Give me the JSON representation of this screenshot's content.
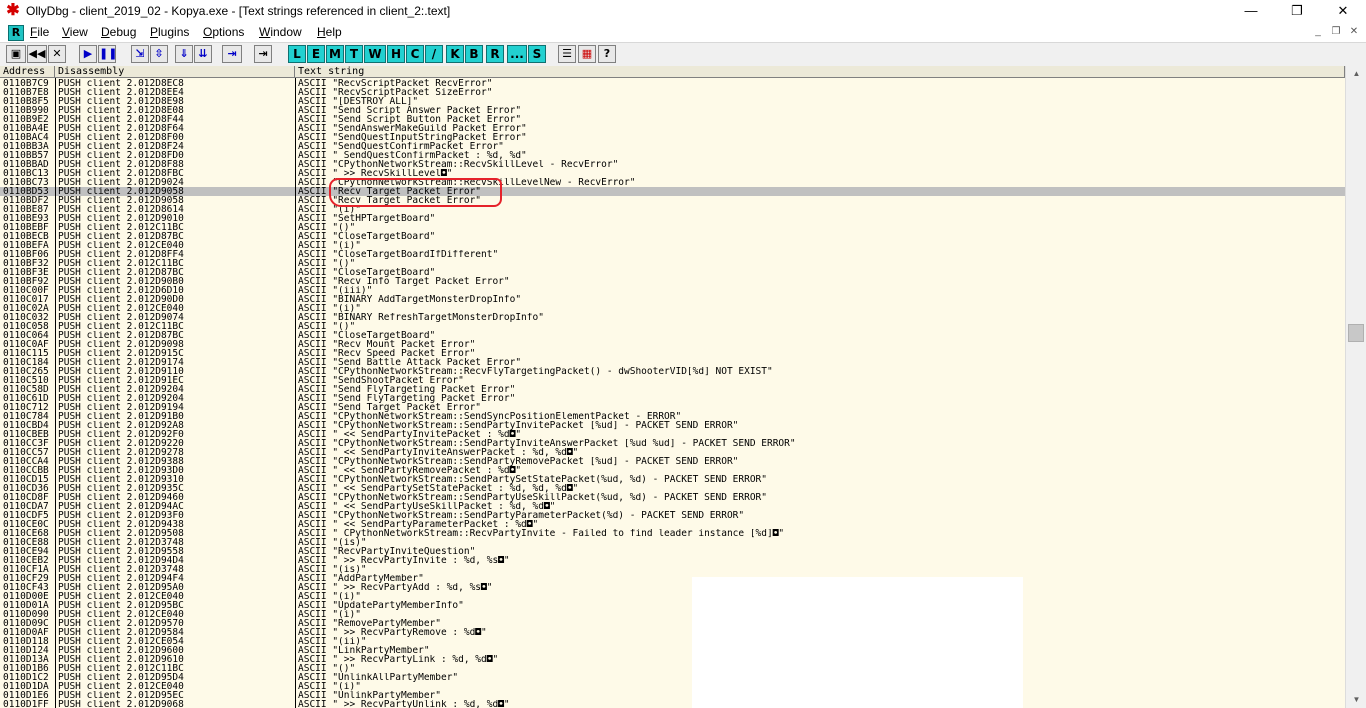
{
  "window": {
    "title": "OllyDbg - client_2019_02 - Kopya.exe - [Text strings referenced in client_2:.text]",
    "minimize_glyph": "—",
    "restore_glyph": "❐",
    "close_glyph": "✕",
    "app_icon_glyph": "✱"
  },
  "menubar": {
    "r_label": "R",
    "items": [
      {
        "u": "F",
        "rest": "ile"
      },
      {
        "u": "V",
        "rest": "iew"
      },
      {
        "u": "D",
        "rest": "ebug"
      },
      {
        "u": "P",
        "rest": "lugins"
      },
      {
        "u": "O",
        "rest": "ptions"
      },
      {
        "u": "W",
        "rest": "indow"
      },
      {
        "u": "H",
        "rest": "elp"
      }
    ],
    "mdi": {
      "min": "_",
      "restore": "❐",
      "close": "✕"
    }
  },
  "toolbar": {
    "buttons": [
      "▣",
      "◀◀",
      "✕",
      "▶",
      "❚❚",
      "⇲",
      "⇳",
      "⇓",
      "⇊",
      "⇥"
    ],
    "letters": [
      "L",
      "E",
      "M",
      "T",
      "W",
      "H",
      "C",
      "/",
      "K",
      "B",
      "R",
      "...",
      "S"
    ],
    "extra": [
      "☰",
      "▦",
      "?"
    ]
  },
  "columns": {
    "address": "Address",
    "disassembly": "Disassembly",
    "text": "Text string"
  },
  "rows": [
    {
      "a": "0110B7C9",
      "d": "PUSH client_2.012D8EC8",
      "t": "ASCII \"RecvScriptPacket_RecvError\""
    },
    {
      "a": "0110B7E8",
      "d": "PUSH client_2.012D8EE4",
      "t": "ASCII \"RecvScriptPacket_SizeError\""
    },
    {
      "a": "0110B8F5",
      "d": "PUSH client_2.012D8E98",
      "t": "ASCII \"[DESTROY_ALL]\""
    },
    {
      "a": "0110B990",
      "d": "PUSH client_2.012D8E08",
      "t": "ASCII \"Send Script Answer Packet Error\""
    },
    {
      "a": "0110B9E2",
      "d": "PUSH client_2.012D8F44",
      "t": "ASCII \"Send Script Button Packet Error\""
    },
    {
      "a": "0110BA4E",
      "d": "PUSH client_2.012D8F64",
      "t": "ASCII \"SendAnswerMakeGuild Packet Error\""
    },
    {
      "a": "0110BAC4",
      "d": "PUSH client_2.012D8F00",
      "t": "ASCII \"SendQuestInputStringPacket Error\""
    },
    {
      "a": "0110BB3A",
      "d": "PUSH client_2.012D8F24",
      "t": "ASCII \"SendQuestConfirmPacket Error\""
    },
    {
      "a": "0110BB57",
      "d": "PUSH client_2.012D8FD0",
      "t": "ASCII \" SendQuestConfirmPacket : %d, %d\""
    },
    {
      "a": "0110BBAD",
      "d": "PUSH client_2.012D8F88",
      "t": "ASCII \"CPythonNetworkStream::RecvSkillLevel - RecvError\""
    },
    {
      "a": "0110BC13",
      "d": "PUSH client_2.012D8FBC",
      "t": "ASCII \" >> RecvSkillLevel◘\""
    },
    {
      "a": "0110BC73",
      "d": "PUSH client_2.012D9024",
      "t": "ASCII \"CPythonNetworkStream::RecvSkillLevelNew - RecvError\""
    },
    {
      "a": "0110BD53",
      "d": "PUSH client_2.012D9058",
      "t": "ASCII \"Recv Target Packet Error\"",
      "sel": true
    },
    {
      "a": "0110BDF2",
      "d": "PUSH client_2.012D9058",
      "t": "ASCII \"Recv Target Packet Error\""
    },
    {
      "a": "0110BE87",
      "d": "PUSH client_2.012D8614",
      "t": "ASCII \"(i)\""
    },
    {
      "a": "0110BE93",
      "d": "PUSH client_2.012D9010",
      "t": "ASCII \"SetHPTargetBoard\""
    },
    {
      "a": "0110BEBF",
      "d": "PUSH client_2.012C11BC",
      "t": "ASCII \"()\""
    },
    {
      "a": "0110BECB",
      "d": "PUSH client_2.012D87BC",
      "t": "ASCII \"CloseTargetBoard\""
    },
    {
      "a": "0110BEFA",
      "d": "PUSH client_2.012CE040",
      "t": "ASCII \"(i)\""
    },
    {
      "a": "0110BF06",
      "d": "PUSH client_2.012D8FF4",
      "t": "ASCII \"CloseTargetBoardIfDifferent\""
    },
    {
      "a": "0110BF32",
      "d": "PUSH client_2.012C11BC",
      "t": "ASCII \"()\""
    },
    {
      "a": "0110BF3E",
      "d": "PUSH client_2.012D87BC",
      "t": "ASCII \"CloseTargetBoard\""
    },
    {
      "a": "0110BF92",
      "d": "PUSH client_2.012D90B0",
      "t": "ASCII \"Recv Info Target Packet Error\""
    },
    {
      "a": "0110C00F",
      "d": "PUSH client_2.012D6D10",
      "t": "ASCII \"(iii)\""
    },
    {
      "a": "0110C017",
      "d": "PUSH client_2.012D90D0",
      "t": "ASCII \"BINARY_AddTargetMonsterDropInfo\""
    },
    {
      "a": "0110C02A",
      "d": "PUSH client_2.012CE040",
      "t": "ASCII \"(i)\""
    },
    {
      "a": "0110C032",
      "d": "PUSH client_2.012D9074",
      "t": "ASCII \"BINARY_RefreshTargetMonsterDropInfo\""
    },
    {
      "a": "0110C058",
      "d": "PUSH client_2.012C11BC",
      "t": "ASCII \"()\""
    },
    {
      "a": "0110C064",
      "d": "PUSH client_2.012D87BC",
      "t": "ASCII \"CloseTargetBoard\""
    },
    {
      "a": "0110C0AF",
      "d": "PUSH client_2.012D9098",
      "t": "ASCII \"Recv Mount Packet Error\""
    },
    {
      "a": "0110C115",
      "d": "PUSH client_2.012D915C",
      "t": "ASCII \"Recv Speed Packet Error\""
    },
    {
      "a": "0110C184",
      "d": "PUSH client_2.012D9174",
      "t": "ASCII \"Send Battle Attack Packet Error\""
    },
    {
      "a": "0110C265",
      "d": "PUSH client_2.012D9110",
      "t": "ASCII \"CPythonNetworkStream::RecvFlyTargetingPacket() - dwShooterVID[%d] NOT EXIST\""
    },
    {
      "a": "0110C510",
      "d": "PUSH client_2.012D91EC",
      "t": "ASCII \"SendShootPacket Error\""
    },
    {
      "a": "0110C58D",
      "d": "PUSH client_2.012D9204",
      "t": "ASCII \"Send FlyTargeting Packet Error\""
    },
    {
      "a": "0110C61D",
      "d": "PUSH client_2.012D9204",
      "t": "ASCII \"Send FlyTargeting Packet Error\""
    },
    {
      "a": "0110C712",
      "d": "PUSH client_2.012D9194",
      "t": "ASCII \"Send Target Packet Error\""
    },
    {
      "a": "0110C784",
      "d": "PUSH client_2.012D91B0",
      "t": "ASCII \"CPythonNetworkStream::SendSyncPositionElementPacket - ERROR\""
    },
    {
      "a": "0110CBD4",
      "d": "PUSH client_2.012D92A8",
      "t": "ASCII \"CPythonNetworkStream::SendPartyInvitePacket [%ud] - PACKET SEND ERROR\""
    },
    {
      "a": "0110CBEB",
      "d": "PUSH client_2.012D92F0",
      "t": "ASCII \" << SendPartyInvitePacket : %d◘\""
    },
    {
      "a": "0110CC3F",
      "d": "PUSH client_2.012D9220",
      "t": "ASCII \"CPythonNetworkStream::SendPartyInviteAnswerPacket [%ud %ud] - PACKET SEND ERROR\""
    },
    {
      "a": "0110CC57",
      "d": "PUSH client_2.012D9278",
      "t": "ASCII \" << SendPartyInviteAnswerPacket : %d, %d◘\""
    },
    {
      "a": "0110CCA4",
      "d": "PUSH client_2.012D9388",
      "t": "ASCII \"CPythonNetworkStream::SendPartyRemovePacket [%ud] - PACKET SEND ERROR\""
    },
    {
      "a": "0110CCBB",
      "d": "PUSH client_2.012D93D0",
      "t": "ASCII \" << SendPartyRemovePacket : %d◘\""
    },
    {
      "a": "0110CD15",
      "d": "PUSH client_2.012D9310",
      "t": "ASCII \"CPythonNetworkStream::SendPartySetStatePacket(%ud, %d) - PACKET SEND ERROR\""
    },
    {
      "a": "0110CD36",
      "d": "PUSH client_2.012D935C",
      "t": "ASCII \" << SendPartySetStatePacket : %d, %d, %d◘\""
    },
    {
      "a": "0110CD8F",
      "d": "PUSH client_2.012D9460",
      "t": "ASCII \"CPythonNetworkStream::SendPartyUseSkillPacket(%ud, %d) - PACKET SEND ERROR\""
    },
    {
      "a": "0110CDA7",
      "d": "PUSH client_2.012D94AC",
      "t": "ASCII \" << SendPartyUseSkillPacket : %d, %d◘\""
    },
    {
      "a": "0110CDF5",
      "d": "PUSH client_2.012D93F0",
      "t": "ASCII \"CPythonNetworkStream::SendPartyParameterPacket(%d) - PACKET SEND ERROR\""
    },
    {
      "a": "0110CE0C",
      "d": "PUSH client_2.012D9438",
      "t": "ASCII \" << SendPartyParameterPacket : %d◘\""
    },
    {
      "a": "0110CE68",
      "d": "PUSH client_2.012D9508",
      "t": "ASCII \" CPythonNetworkStream::RecvPartyInvite - Failed to find leader instance [%d]◘\""
    },
    {
      "a": "0110CE88",
      "d": "PUSH client_2.012D3748",
      "t": "ASCII \"(is)\""
    },
    {
      "a": "0110CE94",
      "d": "PUSH client_2.012D9558",
      "t": "ASCII \"RecvPartyInviteQuestion\""
    },
    {
      "a": "0110CEB2",
      "d": "PUSH client_2.012D94D4",
      "t": "ASCII \" >> RecvPartyInvite : %d, %s◘\""
    },
    {
      "a": "0110CF1A",
      "d": "PUSH client_2.012D3748",
      "t": "ASCII \"(is)\""
    },
    {
      "a": "0110CF29",
      "d": "PUSH client_2.012D94F4",
      "t": "ASCII \"AddPartyMember\""
    },
    {
      "a": "0110CF43",
      "d": "PUSH client_2.012D95A0",
      "t": "ASCII \" >> RecvPartyAdd : %d, %s◘\""
    },
    {
      "a": "0110D00E",
      "d": "PUSH client_2.012CE040",
      "t": "ASCII \"(i)\""
    },
    {
      "a": "0110D01A",
      "d": "PUSH client_2.012D95BC",
      "t": "ASCII \"UpdatePartyMemberInfo\""
    },
    {
      "a": "0110D090",
      "d": "PUSH client_2.012CE040",
      "t": "ASCII \"(i)\""
    },
    {
      "a": "0110D09C",
      "d": "PUSH client_2.012D9570",
      "t": "ASCII \"RemovePartyMember\""
    },
    {
      "a": "0110D0AF",
      "d": "PUSH client_2.012D9584",
      "t": "ASCII \" >> RecvPartyRemove : %d◘\""
    },
    {
      "a": "0110D118",
      "d": "PUSH client_2.012CE054",
      "t": "ASCII \"(ii)\""
    },
    {
      "a": "0110D124",
      "d": "PUSH client_2.012D9600",
      "t": "ASCII \"LinkPartyMember\""
    },
    {
      "a": "0110D13A",
      "d": "PUSH client_2.012D9610",
      "t": "ASCII \" >> RecvPartyLink : %d, %d◘\""
    },
    {
      "a": "0110D1B6",
      "d": "PUSH client_2.012C11BC",
      "t": "ASCII \"()\""
    },
    {
      "a": "0110D1C2",
      "d": "PUSH client_2.012D95D4",
      "t": "ASCII \"UnlinkAllPartyMember\""
    },
    {
      "a": "0110D1DA",
      "d": "PUSH client_2.012CE040",
      "t": "ASCII \"(i)\""
    },
    {
      "a": "0110D1E6",
      "d": "PUSH client_2.012D95EC",
      "t": "ASCII \"UnlinkPartyMember\""
    },
    {
      "a": "0110D1FF",
      "d": "PUSH client_2.012D9068",
      "t": "ASCII \" >> RecvPartyUnlink : %d, %d◘\""
    }
  ],
  "colors": {
    "list_bg": "#fefae8",
    "selected_row": "#c0c0c0",
    "annotation": "#e5222a",
    "letter_buttons": "#22d0d0"
  }
}
